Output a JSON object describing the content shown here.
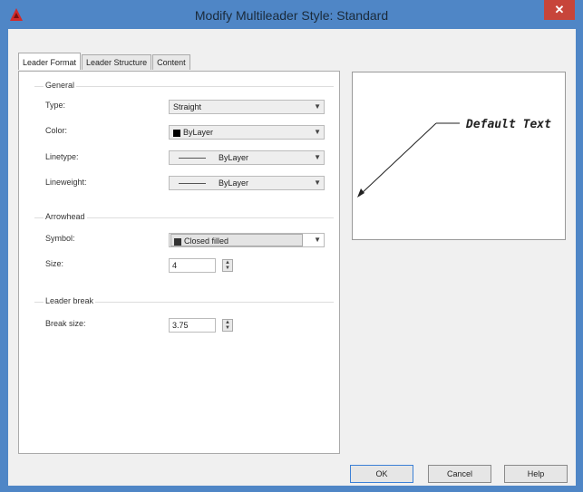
{
  "window": {
    "title": "Modify Multileader Style: Standard",
    "close_glyph": "✕"
  },
  "tabs": [
    {
      "label": "Leader Format",
      "active": true
    },
    {
      "label": "Leader Structure",
      "active": false
    },
    {
      "label": "Content",
      "active": false
    }
  ],
  "general": {
    "heading": "General",
    "type_label": "Type:",
    "type_value": "Straight",
    "color_label": "Color:",
    "color_value": "ByLayer",
    "linetype_label": "Linetype:",
    "linetype_value": "ByLayer",
    "lineweight_label": "Lineweight:",
    "lineweight_value": "ByLayer"
  },
  "arrowhead": {
    "heading": "Arrowhead",
    "symbol_label": "Symbol:",
    "symbol_value": "Closed filled",
    "size_label": "Size:",
    "size_value": "4"
  },
  "leader_break": {
    "heading": "Leader break",
    "break_size_label": "Break size:",
    "break_size_value": "3.75"
  },
  "preview": {
    "text": "Default Text"
  },
  "buttons": {
    "ok": "OK",
    "cancel": "Cancel",
    "help": "Help"
  },
  "colors": {
    "titlebar": "#4f86c6",
    "close": "#c7453a",
    "swatch": "#000000"
  },
  "icons": {
    "app": "autocad-icon",
    "dropdown": "chevron-down-icon",
    "spinner": "spinner-arrows-icon"
  }
}
